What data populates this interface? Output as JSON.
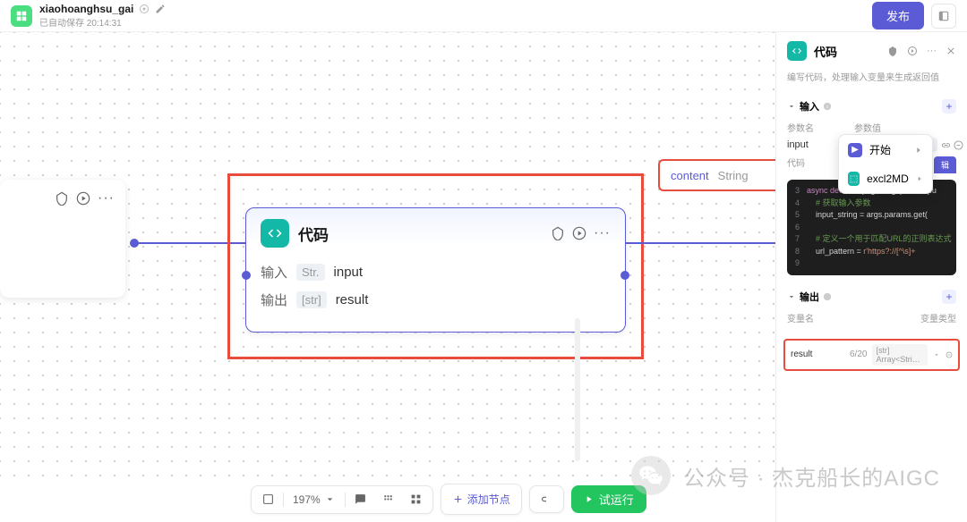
{
  "header": {
    "title": "xiaohoanghsu_gai",
    "subtitle": "已自动保存 20:14:31",
    "publish": "发布"
  },
  "canvas": {
    "selection_tooltip": {
      "key": "content",
      "type": "String"
    },
    "dropdown": {
      "item1": "开始",
      "item2": "excl2MD"
    }
  },
  "code_node": {
    "title": "代码",
    "input_label": "输入",
    "input_badge": "Str.",
    "input_name": "input",
    "output_label": "输出",
    "output_badge": "[str]",
    "output_name": "result"
  },
  "panel": {
    "title": "代码",
    "description": "编写代码，处理输入变量来生成返回值",
    "input_section": "输入",
    "param_name_label": "参数名",
    "param_val_label": "参数值",
    "input_name": "input",
    "input_src_tag": "excl2MD",
    "input_src_val": "content",
    "code_section": "代码",
    "edit_label": "辑",
    "code_lines": [
      {
        "n": "3",
        "text": "async def main(args: Args) -> Outpu"
      },
      {
        "n": "4",
        "text": "    # 获取输入参数"
      },
      {
        "n": "5",
        "text": "    input_string = args.params.get("
      },
      {
        "n": "6",
        "text": ""
      },
      {
        "n": "7",
        "text": "    # 定义一个用于匹配URL的正则表达式"
      },
      {
        "n": "8",
        "text": "    url_pattern = r'https?://[^\\s]+"
      },
      {
        "n": "9",
        "text": ""
      }
    ],
    "output_section": "输出",
    "var_name_label": "变量名",
    "var_type_label": "变量类型",
    "output_name": "result",
    "output_count": "6/20",
    "output_type": "[str] Array<Stri…"
  },
  "bottom": {
    "zoom": "197%",
    "add_node": "添加节点",
    "run": "试运行"
  },
  "watermark": "公众号 · 杰克船长的AIGC"
}
